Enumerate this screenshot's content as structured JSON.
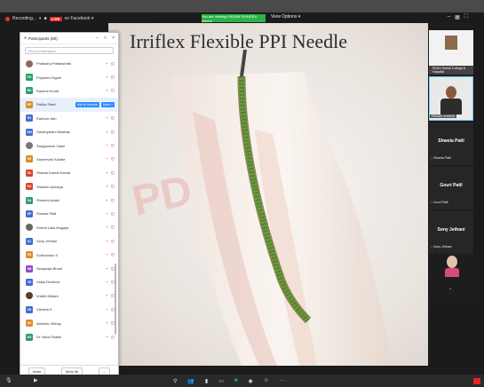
{
  "top": {
    "recording_label": "Recording...",
    "live_label": "LIVE",
    "on_facebook": "on Facebook ▾",
    "viewing_banner": "You are viewing PADAM SHINDE's screen",
    "view_options": "View Options ▾"
  },
  "slide": {
    "title": "Irriflex Flexible PPI Needle"
  },
  "participants": {
    "title": "Participants (50)",
    "search_placeholder": "Find a participant",
    "rows": [
      {
        "initials": "",
        "name": "Pratiksha Pattanshetti",
        "color": "#8a6a5a",
        "photo": true
      },
      {
        "initials": "PD",
        "name": "Priyanka Digole",
        "color": "#2e9b6b"
      },
      {
        "initials": "RK",
        "name": "Rashmi Kondi",
        "color": "#2e9b6b"
      },
      {
        "initials": "RP",
        "name": "Rutika Patel",
        "color": "#e08a2e",
        "highlight": true,
        "ask": "Ask to Unmute",
        "more": "More >"
      },
      {
        "initials": "RJ",
        "name": "Ruthum Jain",
        "color": "#3b6fd6"
      },
      {
        "initials": "SM",
        "name": "Sandhyarani Madbas",
        "color": "#3b6fd6"
      },
      {
        "initials": "",
        "name": "Sangamesh Yaleri",
        "color": "#777",
        "photo": true
      },
      {
        "initials": "SK",
        "name": "Sanmevak Kokate",
        "color": "#e08a2e"
      },
      {
        "initials": "SK",
        "name": "Sharad Kamat Kamat",
        "color": "#d9442f"
      },
      {
        "initials": "SA",
        "name": "Shashin Acharya",
        "color": "#d9442f"
      },
      {
        "initials": "SA",
        "name": "Shrideni Adale",
        "color": "#2e9b6b"
      },
      {
        "initials": "SP",
        "name": "Shweta Patil",
        "color": "#3b6fd6"
      },
      {
        "initials": "",
        "name": "Smruti Lalla Mugaye",
        "color": "#666",
        "photo": true
      },
      {
        "initials": "SJ",
        "name": "Sony Jethani",
        "color": "#3b6fd6"
      },
      {
        "initials": "SS",
        "name": "Sudhanshu S",
        "color": "#e08a2e"
      },
      {
        "initials": "SB",
        "name": "Swapnaja Bhore",
        "color": "#8a4fc7"
      },
      {
        "initials": "VD",
        "name": "Vidya Dhotkod",
        "color": "#3b6fd6"
      },
      {
        "initials": "",
        "name": "Vrddhi Mhatre",
        "color": "#5a3b2e",
        "photo": true
      },
      {
        "initials": "VK",
        "name": "Vishesh K",
        "color": "#3b6fd6"
      },
      {
        "initials": "AV",
        "name": "Abhinav Vibhay",
        "color": "#e08a2e"
      },
      {
        "initials": "DS",
        "name": "Dr Vaiza Shaikh",
        "color": "#2e9b6b"
      }
    ],
    "invite": "Invite",
    "mute_all": "Mute All",
    "more": "..."
  },
  "gallery": {
    "college": "BVDU Dental College & Hospital",
    "presenter": "PADAM SHINDE",
    "tiles": [
      {
        "big": "Shweta Patil",
        "small": "Shweta Patil"
      },
      {
        "big": "Gouri Patil",
        "small": "Gouri Patil"
      },
      {
        "big": "Sony Jethani",
        "small": "Sony Jethani"
      }
    ]
  }
}
